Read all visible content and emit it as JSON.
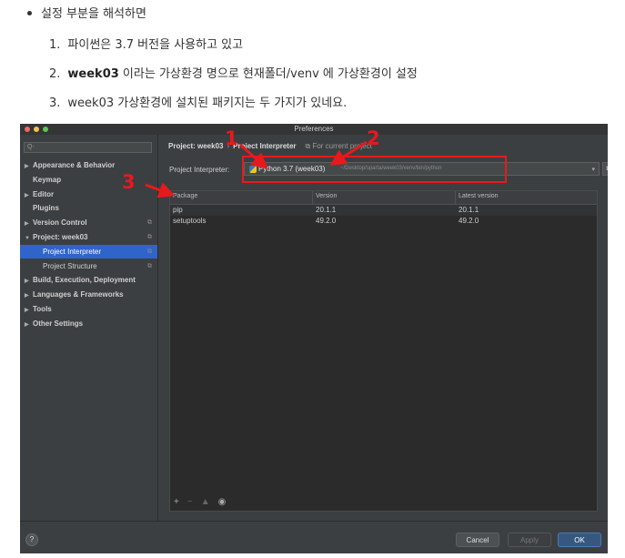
{
  "doc": {
    "bullet": "설정 부분을 해석하면",
    "items": [
      {
        "num": "1.",
        "text": "파이썬은 3.7 버전을 사용하고 있고"
      },
      {
        "num": "2.",
        "bold": "week03",
        "text": " 이라는 가상환경 명으로 현재폴더/venv 에 가상환경이 설정"
      },
      {
        "num": "3.",
        "text": "week03 가상환경에 설치된 패키지는 두 가지가 있네요."
      }
    ]
  },
  "window": {
    "title": "Preferences",
    "traffic_colors": [
      "#ed6a5e",
      "#f5bf4f",
      "#61c554"
    ]
  },
  "sidebar": {
    "search_placeholder": "Q-",
    "items": [
      {
        "label": "Appearance & Behavior",
        "arrow": "▶"
      },
      {
        "label": "Keymap",
        "arrow": ""
      },
      {
        "label": "Editor",
        "arrow": "▶"
      },
      {
        "label": "Plugins",
        "arrow": ""
      },
      {
        "label": "Version Control",
        "arrow": "▶",
        "copy": "⧉"
      },
      {
        "label": "Project: week03",
        "arrow": "▼",
        "copy": "⧉"
      },
      {
        "label": "Project Interpreter",
        "copy": "⧉",
        "selected": true
      },
      {
        "label": "Project Structure",
        "copy": "⧉"
      },
      {
        "label": "Build, Execution, Deployment",
        "arrow": "▶"
      },
      {
        "label": "Languages & Frameworks",
        "arrow": "▶"
      },
      {
        "label": "Tools",
        "arrow": "▶"
      },
      {
        "label": "Other Settings",
        "arrow": "▶"
      }
    ]
  },
  "main": {
    "breadcrumb_project": "Project: week03",
    "breadcrumb_sep": "›",
    "breadcrumb_page": "Project Interpreter",
    "breadcrumb_note": "⧉ For current project",
    "interpreter_label": "Project Interpreter:",
    "interpreter_value": "Python 3.7 (week03)",
    "interpreter_path": "~/Desktop/sparta/week03/venv/bin/python",
    "gear_glyph": "✱",
    "table": {
      "headers": [
        "Package",
        "Version",
        "Latest version"
      ],
      "rows": [
        [
          "pip",
          "20.1.1",
          "20.1.1"
        ],
        [
          "setuptools",
          "49.2.0",
          "49.2.0"
        ]
      ]
    },
    "toolbar": {
      "add": "+",
      "remove": "−",
      "upgrade": "▲",
      "show": "◉"
    }
  },
  "footer": {
    "help": "?",
    "cancel": "Cancel",
    "apply": "Apply",
    "ok": "OK"
  },
  "annotations": {
    "numbers": [
      "1",
      "2",
      "3"
    ],
    "color": "#e8191c"
  }
}
